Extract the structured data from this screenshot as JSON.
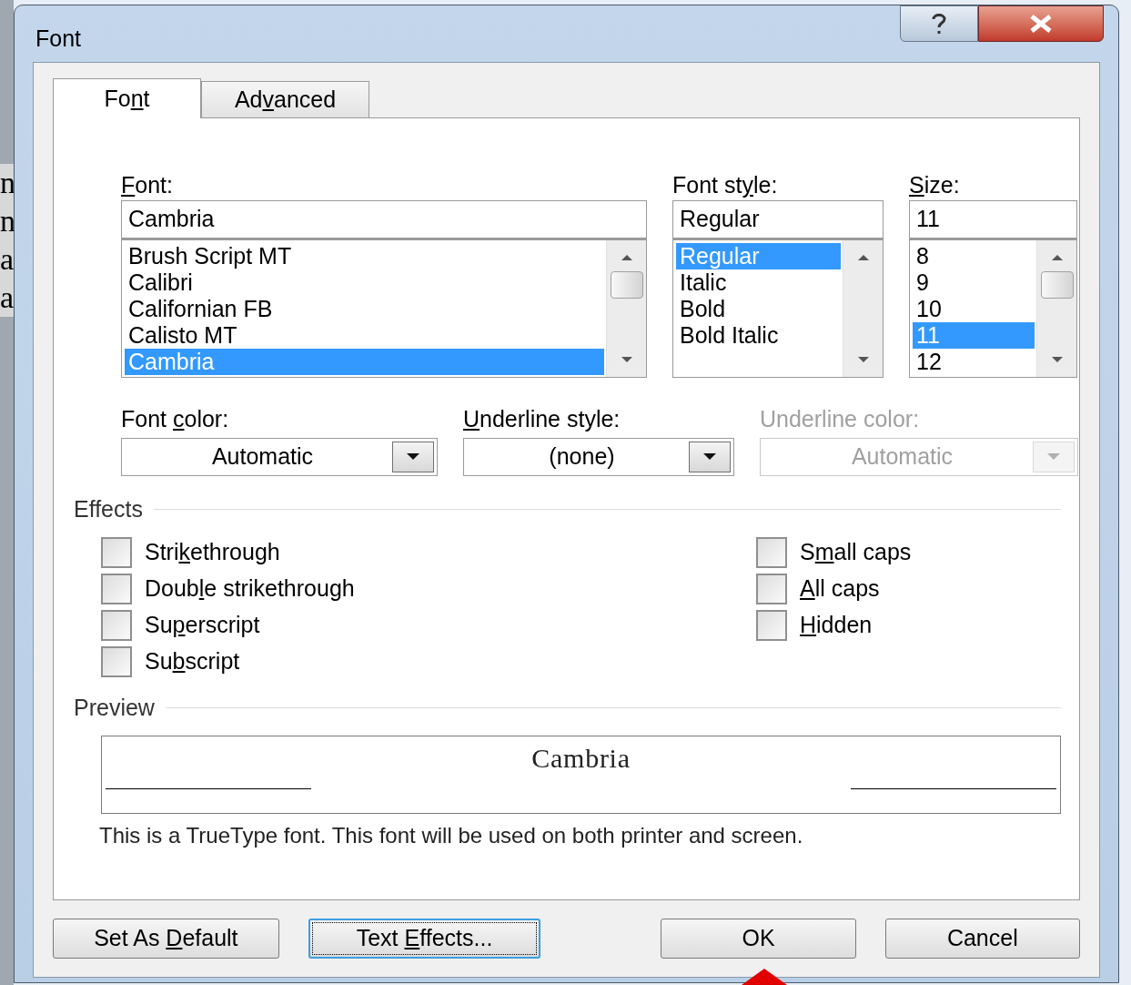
{
  "background_document": {
    "letters": [
      "n",
      "n",
      "a",
      "a"
    ]
  },
  "window": {
    "title": "Font"
  },
  "tabs": [
    {
      "label": [
        "Fo",
        {
          "key": "n"
        },
        "t"
      ],
      "selected": true
    },
    {
      "label": [
        "Ad",
        {
          "key": "v"
        },
        "anced"
      ],
      "selected": false
    }
  ],
  "lists": [
    {
      "label": [
        {
          "key": "F"
        },
        "ont:"
      ],
      "value": "Cambria",
      "items": [
        {
          "text": "Brush Script MT",
          "selected": false
        },
        {
          "text": "Calibri",
          "selected": false
        },
        {
          "text": "Californian FB",
          "selected": false
        },
        {
          "text": "Calisto MT",
          "selected": false
        },
        {
          "text": "Cambria",
          "selected": true
        }
      ]
    },
    {
      "label": [
        "Font st",
        {
          "key": "y"
        },
        "le:"
      ],
      "value": "Regular",
      "items": [
        {
          "text": "Regular",
          "selected": true
        },
        {
          "text": "Italic",
          "selected": false
        },
        {
          "text": "Bold",
          "selected": false
        },
        {
          "text": "Bold Italic",
          "selected": false
        }
      ]
    },
    {
      "label": [
        {
          "key": "S"
        },
        "ize:"
      ],
      "value": "11",
      "items": [
        {
          "text": "8",
          "selected": false
        },
        {
          "text": "9",
          "selected": false
        },
        {
          "text": "10",
          "selected": false
        },
        {
          "text": "11",
          "selected": true
        },
        {
          "text": "12",
          "selected": false
        }
      ]
    }
  ],
  "dropdowns": [
    {
      "label": [
        "Font ",
        {
          "key": "c"
        },
        "olor:"
      ],
      "value": "Automatic",
      "disabled": false
    },
    {
      "label": [
        {
          "key": "U"
        },
        "nderline style:"
      ],
      "value": "(none)",
      "disabled": false
    },
    {
      "label": [
        "Underline color:"
      ],
      "value": "Automatic",
      "disabled": true
    }
  ],
  "effects": {
    "title": "Effects",
    "left": [
      {
        "label": [
          "Stri",
          {
            "key": "k"
          },
          "ethrough"
        ],
        "checked": false
      },
      {
        "label": [
          "Doub",
          {
            "key": "l"
          },
          "e strikethrough"
        ],
        "checked": false
      },
      {
        "label": [
          "Su",
          {
            "key": "p"
          },
          "erscript"
        ],
        "checked": false
      },
      {
        "label": [
          "Su",
          {
            "key": "b"
          },
          "script"
        ],
        "checked": false
      }
    ],
    "right": [
      {
        "label": [
          "S",
          {
            "key": "m"
          },
          "all caps"
        ],
        "checked": false
      },
      {
        "label": [
          {
            "key": "A"
          },
          "ll caps"
        ],
        "checked": false
      },
      {
        "label": [
          {
            "key": "H"
          },
          "idden"
        ],
        "checked": false
      }
    ]
  },
  "preview": {
    "title": "Preview",
    "sample": "Cambria",
    "note": "This is a TrueType font. This font will be used on both printer and screen."
  },
  "buttons": [
    {
      "label": [
        "Set As ",
        {
          "key": "D"
        },
        "efault"
      ],
      "focused": false
    },
    {
      "label": [
        "Text ",
        {
          "key": "E"
        },
        "ffects..."
      ],
      "focused": true
    },
    {
      "label": [
        "OK"
      ],
      "focused": false
    },
    {
      "label": [
        "Cancel"
      ],
      "focused": false
    }
  ]
}
